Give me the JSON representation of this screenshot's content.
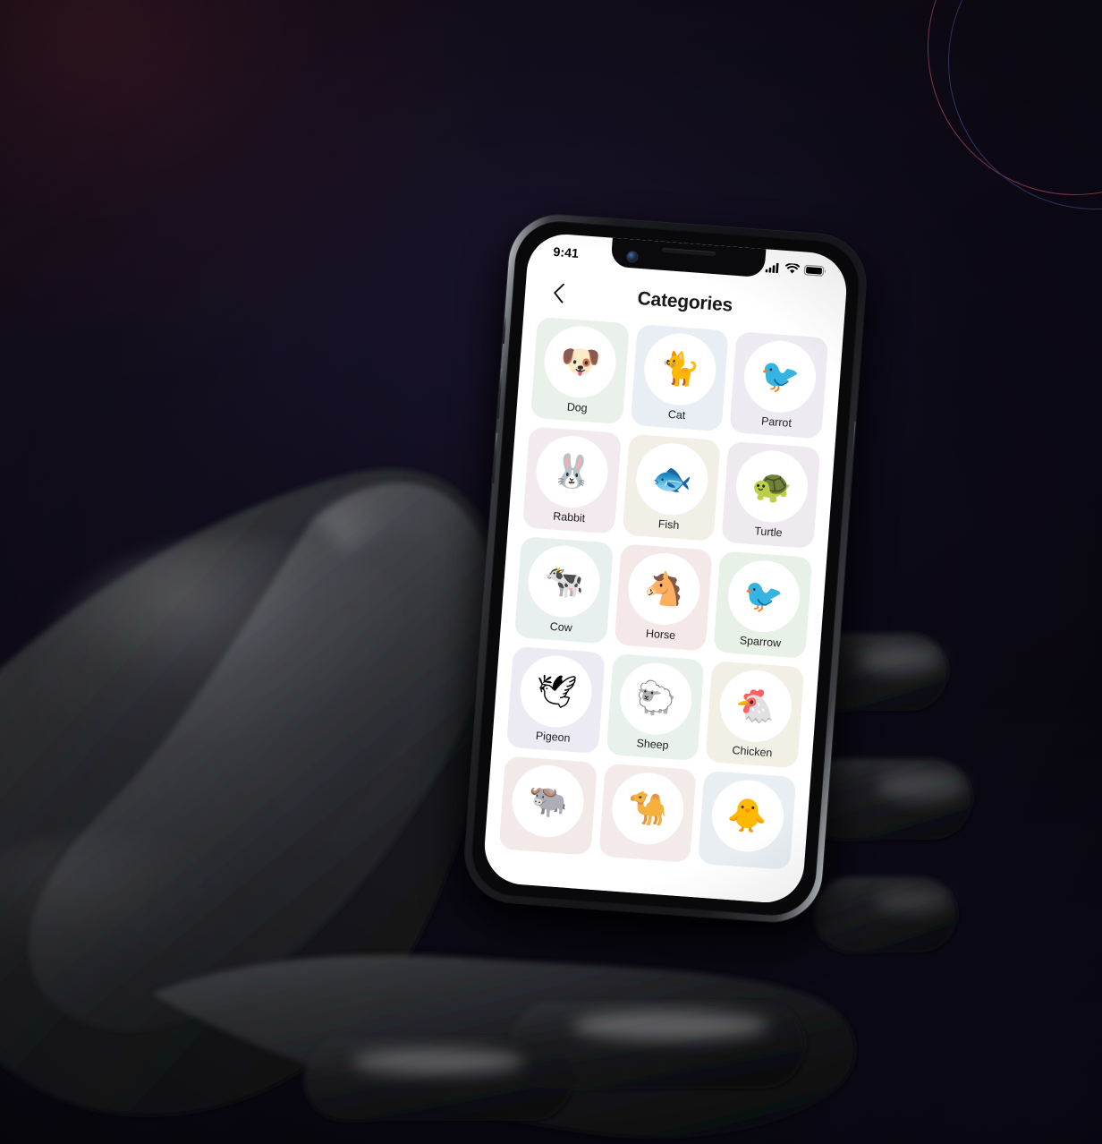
{
  "scene": {
    "background_colors": {
      "base_dark": "#0b0814",
      "glow_maroon": "#56223 4",
      "glow_purple": "#1c1632"
    },
    "decor": {
      "ring_pink_color": "#c5506b",
      "ring_blue_color": "#4a4f9c",
      "ring_count": 2
    },
    "hand": {
      "description": "dark glossy 3d hand holding phone",
      "color": "#1a1a1d"
    }
  },
  "device": {
    "frame_color": "#141518",
    "rail_highlight": "#d8dade",
    "rotation_degrees": 4.2,
    "notch": {
      "camera_icon": "front-camera-icon",
      "speaker_icon": "earpiece-speaker-icon"
    },
    "buttons": [
      "silence-switch",
      "volume-up-button",
      "volume-down-button",
      "power-button"
    ]
  },
  "status_bar": {
    "time": "9:41",
    "icons": [
      "cellular-signal-icon",
      "wifi-icon",
      "battery-icon"
    ],
    "signal_bars": 4,
    "battery_level": 100
  },
  "nav": {
    "back_icon": "chevron-left-icon",
    "title": "Categories"
  },
  "grid": {
    "columns": 3,
    "categories": [
      {
        "label": "Dog",
        "emoji": "🐶",
        "icon": "dog-icon",
        "tint": "#e9f1ea"
      },
      {
        "label": "Cat",
        "emoji": "🐈",
        "icon": "cat-icon",
        "tint": "#e8eef3"
      },
      {
        "label": "Parrot",
        "emoji": "🐦",
        "icon": "parrot-icon",
        "tint": "#eeeaf2"
      },
      {
        "label": "Rabbit",
        "emoji": "🐰",
        "icon": "rabbit-icon",
        "tint": "#f2eaee"
      },
      {
        "label": "Fish",
        "emoji": "🐟",
        "icon": "fish-icon",
        "tint": "#f2efe7"
      },
      {
        "label": "Turtle",
        "emoji": "🐢",
        "icon": "turtle-icon",
        "tint": "#eeeaf0"
      },
      {
        "label": "Cow",
        "emoji": "🐄",
        "icon": "cow-icon",
        "tint": "#e7f0ee"
      },
      {
        "label": "Horse",
        "emoji": "🐴",
        "icon": "horse-icon",
        "tint": "#f4e8e8"
      },
      {
        "label": "Sparrow",
        "emoji": "🐦",
        "icon": "sparrow-icon",
        "tint": "#e7f1e8"
      },
      {
        "label": "Pigeon",
        "emoji": "🕊",
        "icon": "pigeon-icon",
        "tint": "#eceaf3"
      },
      {
        "label": "Sheep",
        "emoji": "🐑",
        "icon": "sheep-icon",
        "tint": "#e8f1ec"
      },
      {
        "label": "Chicken",
        "emoji": "🐔",
        "icon": "chicken-icon",
        "tint": "#f2efe5"
      },
      {
        "label": "",
        "emoji": "🐃",
        "icon": "buffalo-icon",
        "tint": "#f4e9e9"
      },
      {
        "label": "",
        "emoji": "🐪",
        "icon": "camel-icon",
        "tint": "#f3eae9"
      },
      {
        "label": "",
        "emoji": "🐥",
        "icon": "duck-icon",
        "tint": "#e9eef3"
      }
    ]
  }
}
